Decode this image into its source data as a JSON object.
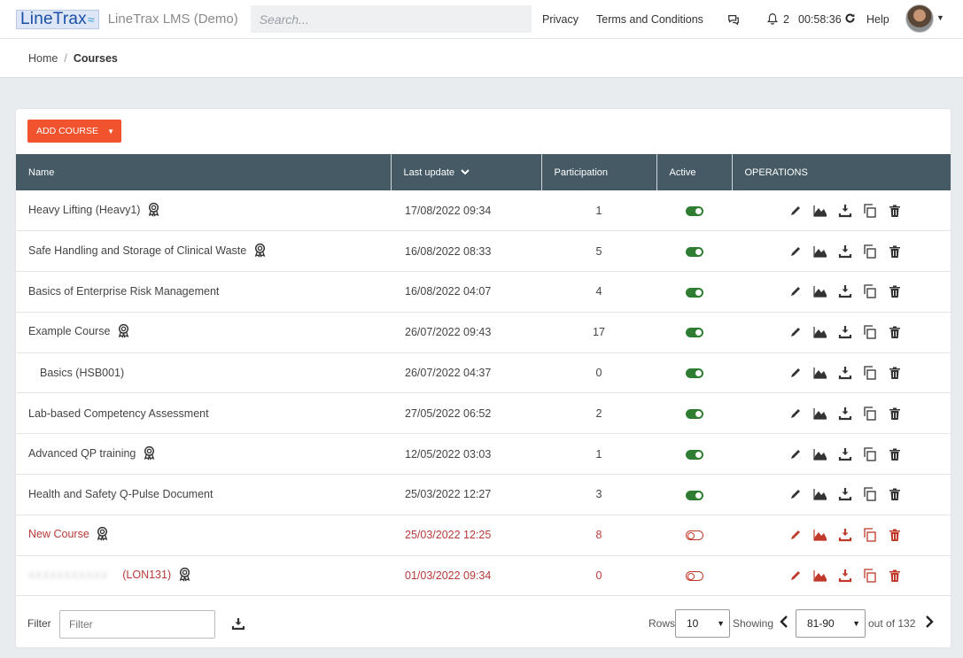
{
  "header": {
    "logo_text": "LineTrax",
    "app_title": "LineTrax LMS (Demo)",
    "search_placeholder": "Search...",
    "nav_privacy": "Privacy",
    "nav_terms": "Terms and Conditions",
    "notifications_count": "2",
    "session_timer": "00:58:36",
    "nav_help": "Help"
  },
  "breadcrumb": {
    "home": "Home",
    "separator": "/",
    "current": "Courses"
  },
  "toolbar": {
    "add_course_label": "ADD COURSE"
  },
  "table": {
    "columns": [
      "Name",
      "Last update",
      "Participation",
      "Active",
      "OPERATIONS"
    ],
    "rows": [
      {
        "name": "Heavy Lifting (Heavy1)",
        "badge": true,
        "indent": false,
        "updated": "17/08/2022 09:34",
        "participation": "1",
        "active": true
      },
      {
        "name": "Safe Handling and Storage of Clinical Waste",
        "badge": true,
        "indent": false,
        "updated": "16/08/2022 08:33",
        "participation": "5",
        "active": true
      },
      {
        "name": "Basics of Enterprise Risk Management",
        "badge": false,
        "indent": false,
        "updated": "16/08/2022 04:07",
        "participation": "4",
        "active": true
      },
      {
        "name": "Example Course",
        "badge": true,
        "indent": false,
        "updated": "26/07/2022 09:43",
        "participation": "17",
        "active": true
      },
      {
        "name": "Basics (HSB001)",
        "badge": false,
        "indent": true,
        "updated": "26/07/2022 04:37",
        "participation": "0",
        "active": true
      },
      {
        "name": "Lab-based Competency Assessment",
        "badge": false,
        "indent": false,
        "updated": "27/05/2022 06:52",
        "participation": "2",
        "active": true
      },
      {
        "name": "Advanced QP training",
        "badge": true,
        "indent": false,
        "updated": "12/05/2022 03:03",
        "participation": "1",
        "active": true
      },
      {
        "name": "Health and Safety Q-Pulse Document",
        "badge": false,
        "indent": false,
        "updated": "25/03/2022 12:27",
        "participation": "3",
        "active": true
      },
      {
        "name": "New Course",
        "badge": true,
        "indent": false,
        "updated": "25/03/2022 12:25",
        "participation": "8",
        "active": false
      },
      {
        "name": "(LON131)",
        "badge": true,
        "indent": false,
        "blurred_prefix": true,
        "updated": "01/03/2022 09:34",
        "participation": "0",
        "active": false
      }
    ]
  },
  "footer": {
    "filter_label": "Filter",
    "filter_placeholder": "Filter",
    "rows_label": "Rows",
    "rows_value": "10",
    "showing_label": "Showing",
    "page_range": "81-90",
    "out_of_label": "out of 132"
  },
  "colors": {
    "accent": "#f0532d",
    "header_bg": "#455a64",
    "active_green": "#2e7d32",
    "inactive_red": "#b73a3a"
  },
  "icons": [
    "search-icon",
    "chat-icon",
    "bell-icon",
    "refresh-icon",
    "chevron-down-icon",
    "award-icon",
    "edit-icon",
    "chart-icon",
    "download-icon",
    "copy-icon",
    "trash-icon",
    "chevron-left-icon",
    "chevron-right-icon"
  ]
}
